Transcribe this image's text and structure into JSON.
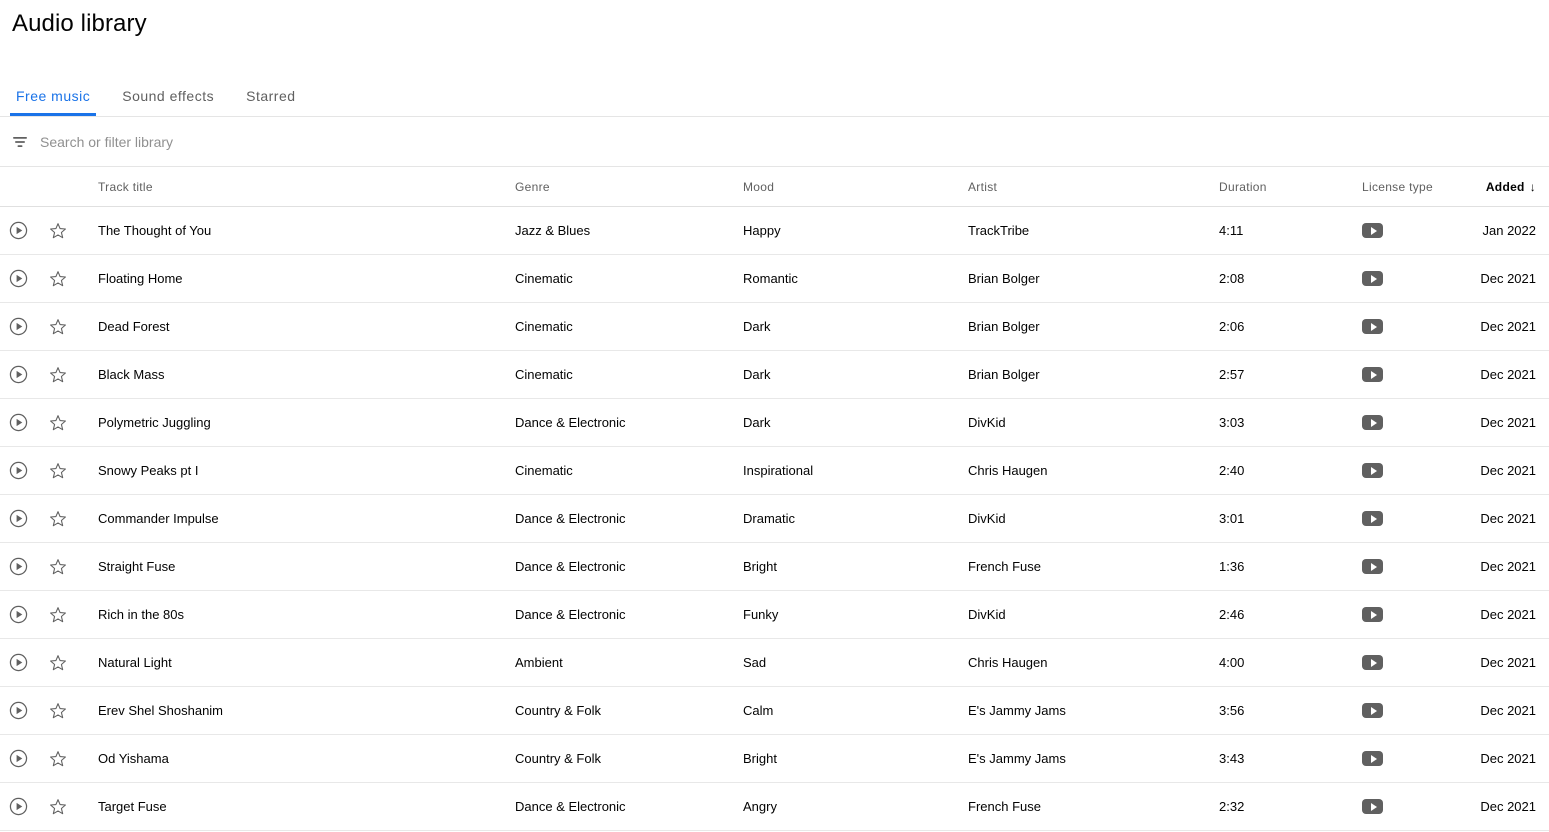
{
  "header": {
    "title": "Audio library"
  },
  "tabs": [
    {
      "label": "Free music",
      "active": true
    },
    {
      "label": "Sound effects",
      "active": false
    },
    {
      "label": "Starred",
      "active": false
    }
  ],
  "search": {
    "placeholder": "Search or filter library",
    "value": "",
    "filter_icon": "filter-list-icon"
  },
  "table": {
    "columns": {
      "track_title": "Track title",
      "genre": "Genre",
      "mood": "Mood",
      "artist": "Artist",
      "duration": "Duration",
      "license_type": "License type",
      "added": "Added"
    },
    "sort": {
      "column": "Added",
      "direction": "descending",
      "arrow": "↓"
    },
    "row_icons": {
      "play": "play-circle-icon",
      "star": "star-outline-icon",
      "license": "youtube-play-badge-icon"
    },
    "rows": [
      {
        "title": "The Thought of You",
        "genre": "Jazz & Blues",
        "mood": "Happy",
        "artist": "TrackTribe",
        "duration": "4:11",
        "added": "Jan 2022"
      },
      {
        "title": "Floating Home",
        "genre": "Cinematic",
        "mood": "Romantic",
        "artist": "Brian Bolger",
        "duration": "2:08",
        "added": "Dec 2021"
      },
      {
        "title": "Dead Forest",
        "genre": "Cinematic",
        "mood": "Dark",
        "artist": "Brian Bolger",
        "duration": "2:06",
        "added": "Dec 2021"
      },
      {
        "title": "Black Mass",
        "genre": "Cinematic",
        "mood": "Dark",
        "artist": "Brian Bolger",
        "duration": "2:57",
        "added": "Dec 2021"
      },
      {
        "title": "Polymetric Juggling",
        "genre": "Dance & Electronic",
        "mood": "Dark",
        "artist": "DivKid",
        "duration": "3:03",
        "added": "Dec 2021"
      },
      {
        "title": "Snowy Peaks pt I",
        "genre": "Cinematic",
        "mood": "Inspirational",
        "artist": "Chris Haugen",
        "duration": "2:40",
        "added": "Dec 2021"
      },
      {
        "title": "Commander Impulse",
        "genre": "Dance & Electronic",
        "mood": "Dramatic",
        "artist": "DivKid",
        "duration": "3:01",
        "added": "Dec 2021"
      },
      {
        "title": "Straight Fuse",
        "genre": "Dance & Electronic",
        "mood": "Bright",
        "artist": "French Fuse",
        "duration": "1:36",
        "added": "Dec 2021"
      },
      {
        "title": "Rich in the 80s",
        "genre": "Dance & Electronic",
        "mood": "Funky",
        "artist": "DivKid",
        "duration": "2:46",
        "added": "Dec 2021"
      },
      {
        "title": "Natural Light",
        "genre": "Ambient",
        "mood": "Sad",
        "artist": "Chris Haugen",
        "duration": "4:00",
        "added": "Dec 2021"
      },
      {
        "title": "Erev Shel Shoshanim",
        "genre": "Country & Folk",
        "mood": "Calm",
        "artist": "E's Jammy Jams",
        "duration": "3:56",
        "added": "Dec 2021"
      },
      {
        "title": "Od Yishama",
        "genre": "Country & Folk",
        "mood": "Bright",
        "artist": "E's Jammy Jams",
        "duration": "3:43",
        "added": "Dec 2021"
      },
      {
        "title": "Target Fuse",
        "genre": "Dance & Electronic",
        "mood": "Angry",
        "artist": "French Fuse",
        "duration": "2:32",
        "added": "Dec 2021"
      }
    ]
  },
  "colors": {
    "accent": "#1a73e8",
    "text_primary": "#030303",
    "text_secondary": "#606060",
    "divider": "#e5e5e5",
    "badge": "#606060"
  }
}
